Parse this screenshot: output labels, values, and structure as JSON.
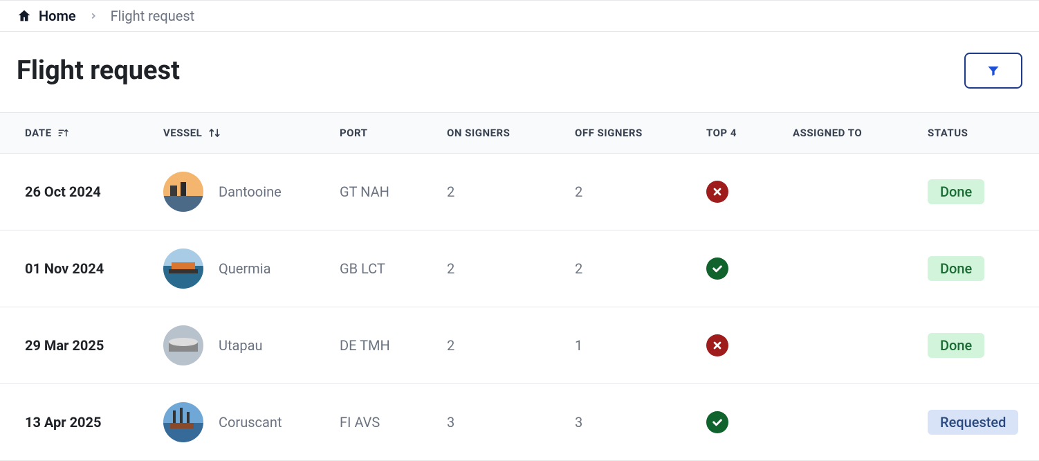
{
  "breadcrumb": {
    "home_label": "Home",
    "current": "Flight request"
  },
  "page_title": "Flight request",
  "columns": {
    "date": "DATE",
    "vessel": "VESSEL",
    "port": "PORT",
    "on_signers": "ON SIGNERS",
    "off_signers": "OFF SIGNERS",
    "top4": "TOP 4",
    "assigned_to": "ASSIGNED TO",
    "status": "STATUS"
  },
  "rows": [
    {
      "date": "26 Oct 2024",
      "vessel": "Dantooine",
      "port": "GT NAH",
      "on_signers": "2",
      "off_signers": "2",
      "top4": false,
      "assigned_to": "",
      "status": "Done",
      "status_kind": "done"
    },
    {
      "date": "01 Nov 2024",
      "vessel": "Quermia",
      "port": "GB LCT",
      "on_signers": "2",
      "off_signers": "2",
      "top4": true,
      "assigned_to": "",
      "status": "Done",
      "status_kind": "done"
    },
    {
      "date": "29 Mar 2025",
      "vessel": "Utapau",
      "port": "DE TMH",
      "on_signers": "2",
      "off_signers": "1",
      "top4": false,
      "assigned_to": "",
      "status": "Done",
      "status_kind": "done"
    },
    {
      "date": "13 Apr 2025",
      "vessel": "Coruscant",
      "port": "FI AVS",
      "on_signers": "3",
      "off_signers": "3",
      "top4": true,
      "assigned_to": "",
      "status": "Requested",
      "status_kind": "requested"
    }
  ]
}
